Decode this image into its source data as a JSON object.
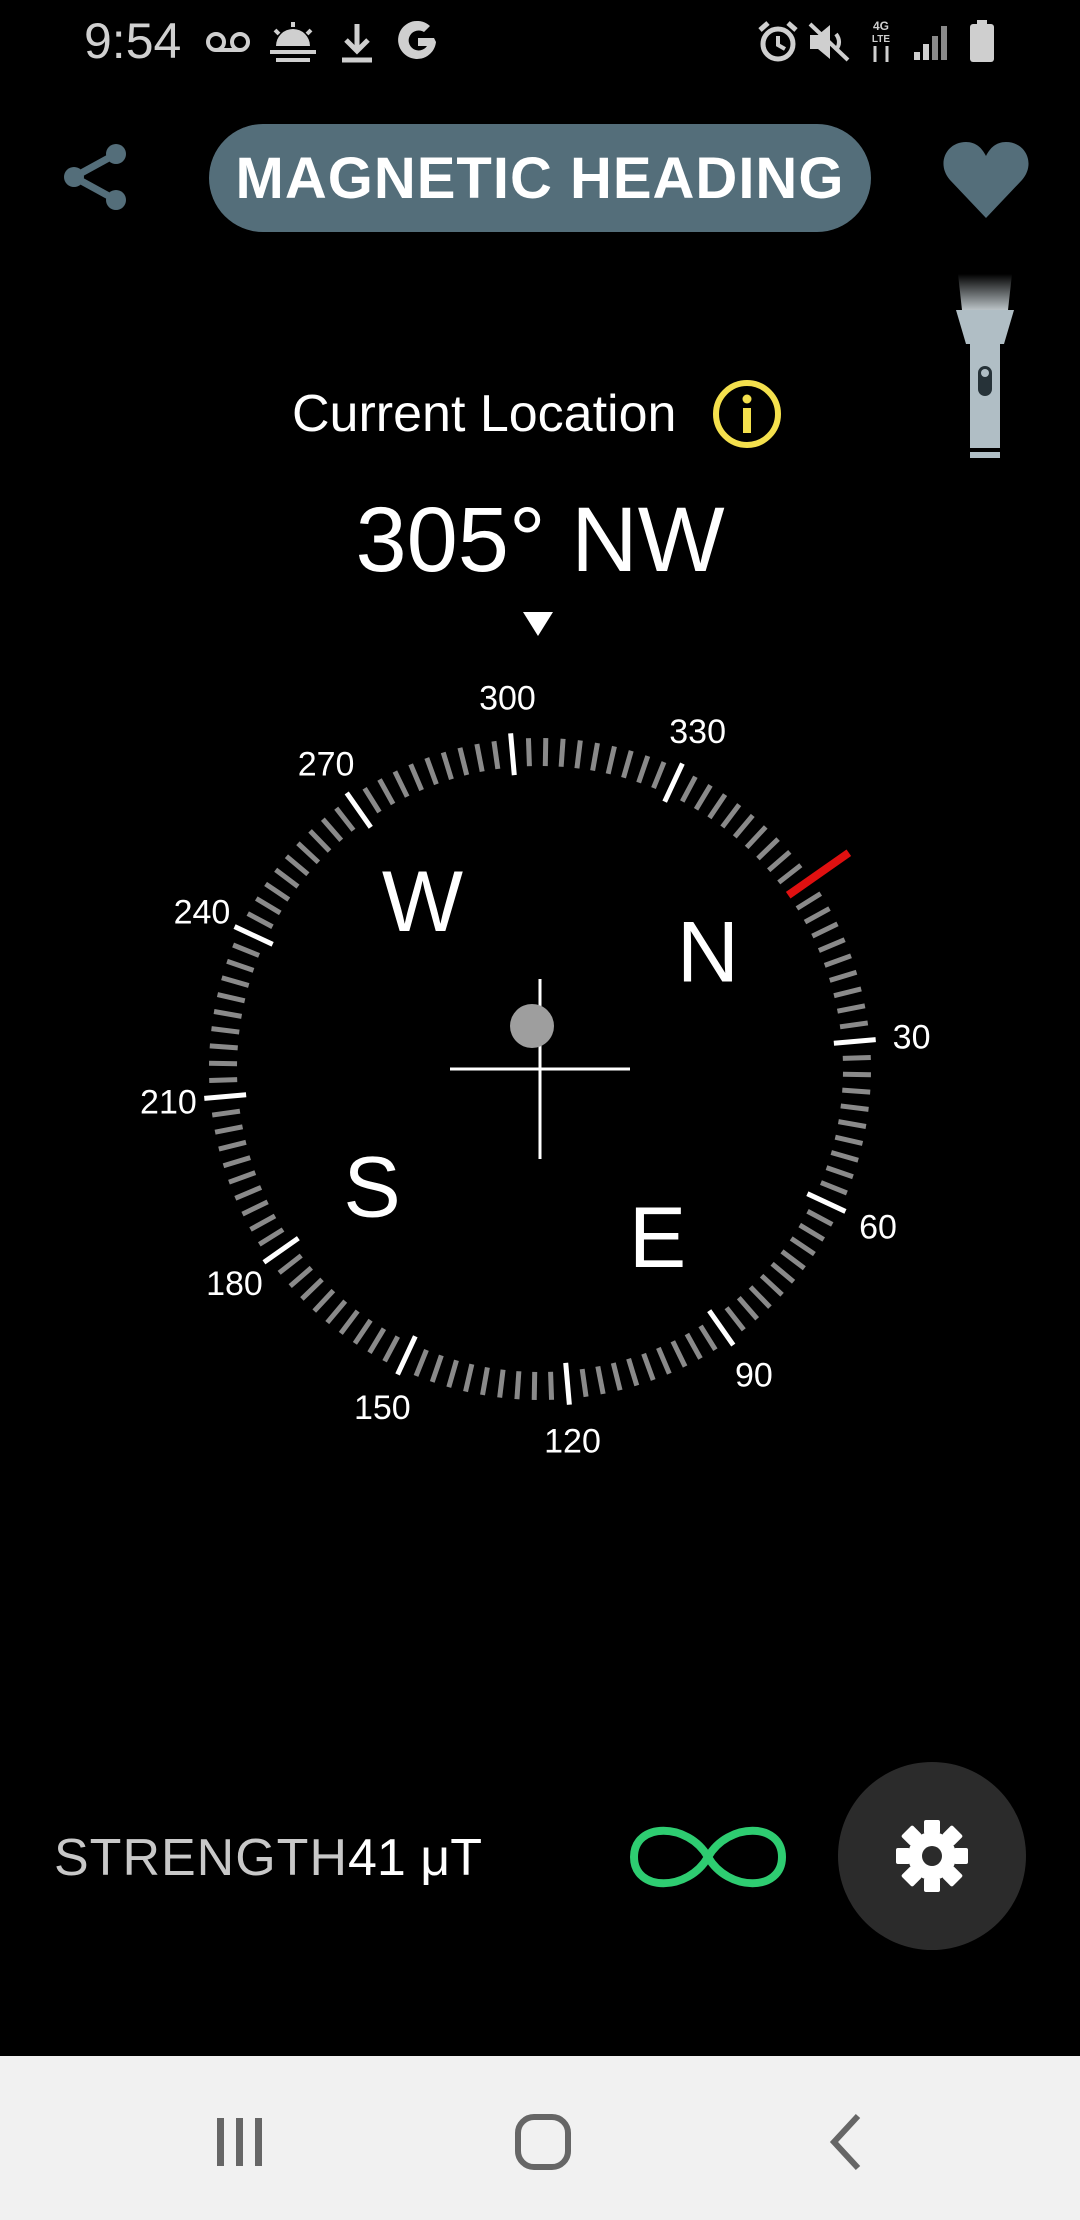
{
  "status_bar": {
    "time": "9:54",
    "icons": [
      "voicemail-icon",
      "weather-icon",
      "download-icon",
      "google-icon",
      "alarm-icon",
      "mute-icon",
      "lte-data-icon",
      "signal-icon",
      "battery-icon"
    ]
  },
  "header": {
    "title": "MAGNETIC HEADING",
    "share_icon": "share-icon",
    "favorite_icon": "heart-icon",
    "flashlight_icon": "flashlight-icon"
  },
  "location": {
    "label": "Current Location",
    "info_icon": "info-icon"
  },
  "heading": {
    "text": "305° NW",
    "degrees": 305
  },
  "compass": {
    "cardinals": [
      "N",
      "E",
      "S",
      "W"
    ],
    "degree_labels": [
      "30",
      "60",
      "90",
      "120",
      "150",
      "180",
      "210",
      "240",
      "270",
      "300",
      "330"
    ],
    "north_marker_color": "#e01010",
    "heading_pointer_icon": "triangle-down-icon"
  },
  "footer": {
    "strength_label": "STRENGTH",
    "strength_value": "41 μT",
    "calibration_icon": "infinity-icon",
    "calibration_color": "#2ecc71",
    "settings_icon": "gear-icon"
  },
  "nav_bar": {
    "icons": [
      "recent-apps-icon",
      "home-icon",
      "back-icon"
    ]
  }
}
